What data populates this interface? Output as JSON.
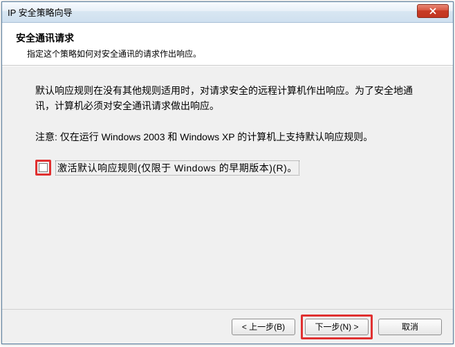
{
  "window": {
    "title": "IP 安全策略向导"
  },
  "header": {
    "title": "安全通讯请求",
    "subtitle": "指定这个策略如何对安全通讯的请求作出响应。"
  },
  "content": {
    "paragraph1": "默认响应规则在没有其他规则适用时，对请求安全的远程计算机作出响应。为了安全地通讯，计算机必须对安全通讯请求做出响应。",
    "paragraph2": "注意: 仅在运行 Windows 2003 和 Windows XP 的计算机上支持默认响应规则。",
    "checkbox_label": "激活默认响应规则(仅限于 Windows 的早期版本)(R)。"
  },
  "buttons": {
    "back": "< 上一步(B)",
    "next": "下一步(N) >",
    "cancel": "取消"
  }
}
